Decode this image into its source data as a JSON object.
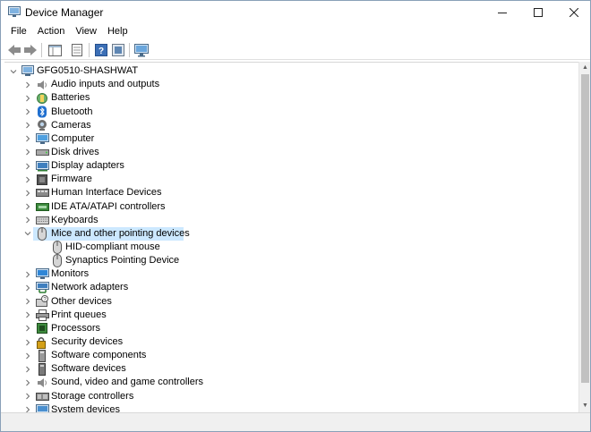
{
  "window": {
    "title": "Device Manager",
    "controls": {
      "minimize": "—",
      "maximize": "☐",
      "close": "✕"
    }
  },
  "menu": [
    "File",
    "Action",
    "View",
    "Help"
  ],
  "toolbar": [
    "back-icon",
    "forward-icon",
    "show-hide-tree-icon",
    "properties-icon",
    "help-icon",
    "scan-hardware-icon"
  ],
  "tree": {
    "root": "GFG0510-SHASHWAT",
    "categories": [
      {
        "label": "Audio inputs and outputs",
        "icon": "speaker-icon"
      },
      {
        "label": "Batteries",
        "icon": "battery-icon"
      },
      {
        "label": "Bluetooth",
        "icon": "bluetooth-icon"
      },
      {
        "label": "Cameras",
        "icon": "camera-icon"
      },
      {
        "label": "Computer",
        "icon": "computer-icon"
      },
      {
        "label": "Disk drives",
        "icon": "disk-drive-icon"
      },
      {
        "label": "Display adapters",
        "icon": "display-adapter-icon"
      },
      {
        "label": "Firmware",
        "icon": "firmware-icon"
      },
      {
        "label": "Human Interface Devices",
        "icon": "hid-icon"
      },
      {
        "label": "IDE ATA/ATAPI controllers",
        "icon": "ide-controller-icon"
      },
      {
        "label": "Keyboards",
        "icon": "keyboard-icon"
      },
      {
        "label": "Mice and other pointing devices",
        "icon": "mouse-icon",
        "expanded": true,
        "selected": true,
        "children": [
          "HID-compliant mouse",
          "Synaptics Pointing Device"
        ]
      },
      {
        "label": "Monitors",
        "icon": "monitor-icon"
      },
      {
        "label": "Network adapters",
        "icon": "network-adapter-icon"
      },
      {
        "label": "Other devices",
        "icon": "other-devices-icon"
      },
      {
        "label": "Print queues",
        "icon": "printer-icon"
      },
      {
        "label": "Processors",
        "icon": "processor-icon"
      },
      {
        "label": "Security devices",
        "icon": "security-device-icon"
      },
      {
        "label": "Software components",
        "icon": "software-component-icon"
      },
      {
        "label": "Software devices",
        "icon": "software-device-icon"
      },
      {
        "label": "Sound, video and game controllers",
        "icon": "sound-controller-icon"
      },
      {
        "label": "Storage controllers",
        "icon": "storage-controller-icon"
      },
      {
        "label": "System devices",
        "icon": "system-devices-icon"
      }
    ]
  },
  "colors": {
    "selection": "#cce8ff",
    "expander": "#6b6b6b"
  }
}
